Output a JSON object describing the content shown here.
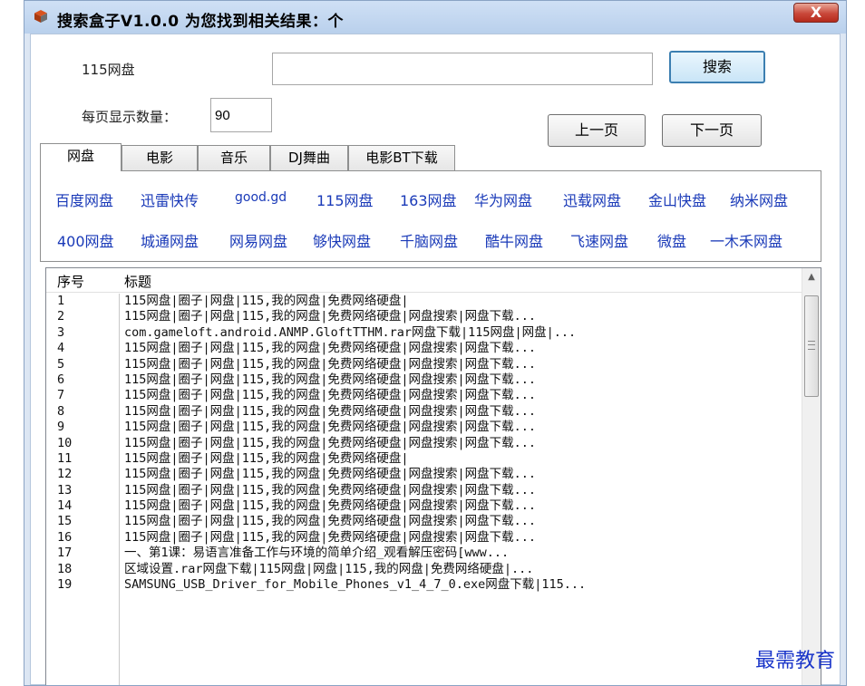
{
  "window": {
    "title": "搜索盒子V1.0.0 为您找到相关结果：个",
    "close_label": "X",
    "app_icon": "app-box-icon"
  },
  "search": {
    "site_label": "115网盘",
    "query_value": "",
    "search_button": "搜索",
    "page_size_label": "每页显示数量：",
    "page_size_value": "90",
    "prev_button": "上一页",
    "next_button": "下一页"
  },
  "tabs": [
    {
      "label": "网盘",
      "active": true
    },
    {
      "label": "电影",
      "active": false
    },
    {
      "label": "音乐",
      "active": false
    },
    {
      "label": "DJ舞曲",
      "active": false
    },
    {
      "label": "电影BT下载",
      "active": false
    }
  ],
  "sites": {
    "row1": [
      "百度网盘",
      "迅雷快传",
      "good.gd",
      "115网盘",
      "163网盘",
      "华为网盘",
      "迅载网盘",
      "金山快盘",
      "纳米网盘"
    ],
    "row2": [
      "400网盘",
      "城通网盘",
      "网易网盘",
      "够快网盘",
      "千脑网盘",
      "酷牛网盘",
      "飞速网盘",
      "微盘",
      "一木禾网盘"
    ]
  },
  "results": {
    "columns": {
      "no": "序号",
      "title": "标题"
    },
    "rows": [
      {
        "no": "1",
        "title": "115网盘|圈子|网盘|115,我的网盘|免费网络硬盘|"
      },
      {
        "no": "2",
        "title": "115网盘|圈子|网盘|115,我的网盘|免费网络硬盘|网盘搜索|网盘下载..."
      },
      {
        "no": "3",
        "title": "com.gameloft.android.ANMP.GloftTTHM.rar网盘下载|115网盘|网盘|..."
      },
      {
        "no": "4",
        "title": "115网盘|圈子|网盘|115,我的网盘|免费网络硬盘|网盘搜索|网盘下载..."
      },
      {
        "no": "5",
        "title": "115网盘|圈子|网盘|115,我的网盘|免费网络硬盘|网盘搜索|网盘下载..."
      },
      {
        "no": "6",
        "title": "115网盘|圈子|网盘|115,我的网盘|免费网络硬盘|网盘搜索|网盘下载..."
      },
      {
        "no": "7",
        "title": "115网盘|圈子|网盘|115,我的网盘|免费网络硬盘|网盘搜索|网盘下载..."
      },
      {
        "no": "8",
        "title": "115网盘|圈子|网盘|115,我的网盘|免费网络硬盘|网盘搜索|网盘下载..."
      },
      {
        "no": "9",
        "title": "115网盘|圈子|网盘|115,我的网盘|免费网络硬盘|网盘搜索|网盘下载..."
      },
      {
        "no": "10",
        "title": "115网盘|圈子|网盘|115,我的网盘|免费网络硬盘|网盘搜索|网盘下载..."
      },
      {
        "no": "11",
        "title": "115网盘|圈子|网盘|115,我的网盘|免费网络硬盘|"
      },
      {
        "no": "12",
        "title": "115网盘|圈子|网盘|115,我的网盘|免费网络硬盘|网盘搜索|网盘下载..."
      },
      {
        "no": "13",
        "title": "115网盘|圈子|网盘|115,我的网盘|免费网络硬盘|网盘搜索|网盘下载..."
      },
      {
        "no": "14",
        "title": "115网盘|圈子|网盘|115,我的网盘|免费网络硬盘|网盘搜索|网盘下载..."
      },
      {
        "no": "15",
        "title": "115网盘|圈子|网盘|115,我的网盘|免费网络硬盘|网盘搜索|网盘下载..."
      },
      {
        "no": "16",
        "title": "115网盘|圈子|网盘|115,我的网盘|免费网络硬盘|网盘搜索|网盘下载..."
      },
      {
        "no": "17",
        "title": "一、第1课：易语言准备工作与环境的简单介绍_观看解压密码[www..."
      },
      {
        "no": "18",
        "title": "区域设置.rar网盘下载|115网盘|网盘|115,我的网盘|免费网络硬盘|..."
      },
      {
        "no": "19",
        "title": "SAMSUNG_USB_Driver_for_Mobile_Phones_v1_4_7_0.exe网盘下载|115..."
      }
    ]
  },
  "watermark": "最需教育",
  "colors": {
    "link": "#1a3ab8",
    "watermark": "#1a35c9",
    "close": "#c9483a"
  }
}
